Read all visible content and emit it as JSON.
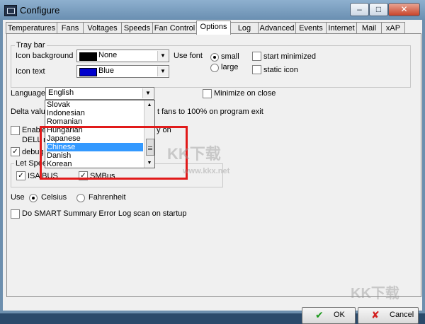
{
  "window": {
    "title": "Configure"
  },
  "tabs": [
    "Temperatures",
    "Fans",
    "Voltages",
    "Speeds",
    "Fan Control",
    "Options",
    "Log",
    "Advanced",
    "Events",
    "Internet",
    "Mail",
    "xAP"
  ],
  "active_tab": "Options",
  "tray_bar": {
    "title": "Tray bar",
    "icon_background_label": "Icon background",
    "icon_background_value": "None",
    "icon_background_color": "#000000",
    "icon_text_label": "Icon text",
    "icon_text_value": "Blue",
    "icon_text_color": "#0000cc",
    "use_font_label": "Use font",
    "font_small": "small",
    "font_large": "large",
    "start_minimized": "start minimized",
    "static_icon": "static icon"
  },
  "language": {
    "label": "Language",
    "value": "English",
    "options": [
      "Slovak",
      "Indonesian",
      "Romanian",
      "Hungarian",
      "Japanese",
      "Chinese",
      "Danish",
      "Korean"
    ],
    "selected": "Chinese"
  },
  "minimize_on_close": "Minimize on close",
  "delta_value_label": "Delta value",
  "fans_100_label": "t fans to 100% on program exit",
  "enable_label": "Enable",
  "dell_label": "DELL n",
  "on_label": "y on",
  "debug_label": "debug",
  "let_speed_label": "Let Spee",
  "isa_bus": "ISA BUS",
  "smbus": "SMBus",
  "use_label": "Use",
  "celsius": "Celsius",
  "fahrenheit": "Fahrenheit",
  "smart_label": "Do SMART Summary Error Log scan on startup",
  "buttons": {
    "ok": "OK",
    "cancel": "Cancel"
  },
  "watermark": {
    "brand": "KK下载",
    "url": "www.kkx.net"
  }
}
